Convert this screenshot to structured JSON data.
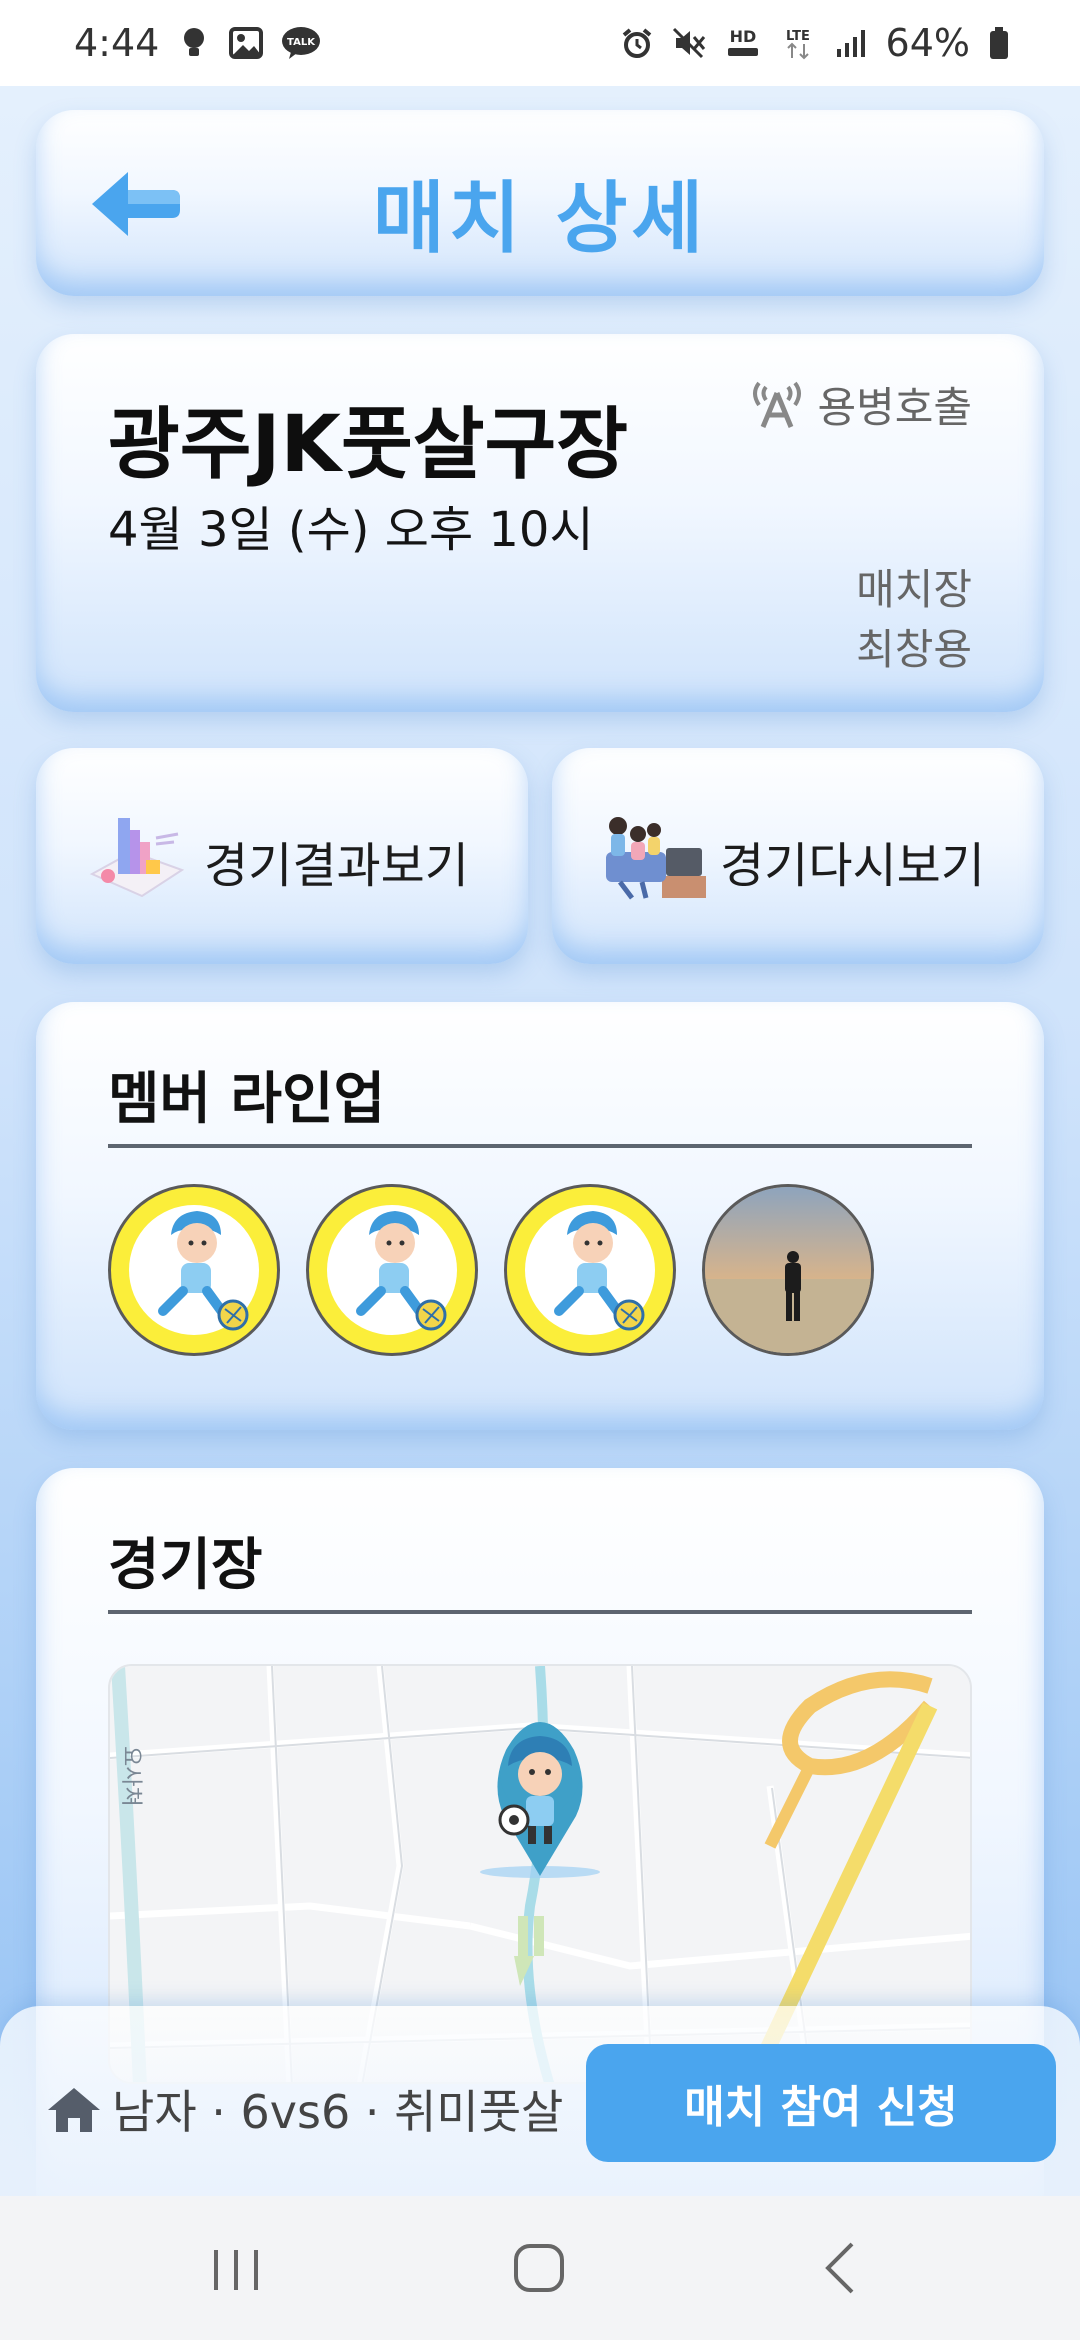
{
  "status_bar": {
    "time": "4:44",
    "battery_text": "64%",
    "left_icons": [
      "bulb-icon",
      "gallery-icon",
      "talk-icon"
    ],
    "talk_badge": "TALK",
    "hd_label": "HD",
    "lte_label": "LTE",
    "right_icons": [
      "alarm-icon",
      "mute-icon",
      "hd-voice-icon",
      "lte-icon",
      "signal-icon",
      "battery-icon"
    ]
  },
  "header": {
    "title": "매치 상세"
  },
  "match": {
    "venue": "광주JK풋살구장",
    "date": "4월 3일 (수) 오후 10시",
    "mercenary_label": "용병호출",
    "host_title": "매치장",
    "host_name": "최창용"
  },
  "actions": {
    "results_label": "경기결과보기",
    "replay_label": "경기다시보기"
  },
  "lineup": {
    "title": "멤버 라인업",
    "members": [
      "default-player-avatar",
      "default-player-avatar",
      "default-player-avatar",
      "photo-avatar"
    ]
  },
  "stadium": {
    "title": "경기장",
    "map_label": "요사쳐"
  },
  "bottom": {
    "info": "남자 · 6vs6 · 취미풋살",
    "apply_label": "매치 참여 신청"
  },
  "colors": {
    "accent": "#4aa5ee",
    "avatar_ring": "#fbee3a"
  }
}
